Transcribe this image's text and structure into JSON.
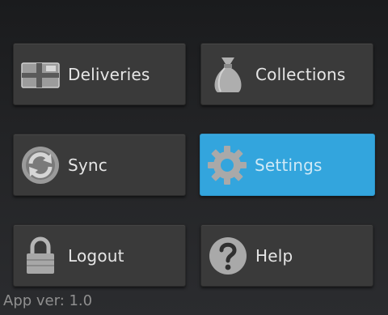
{
  "menu": {
    "deliveries": {
      "label": "Deliveries",
      "icon": "parcel-icon"
    },
    "collections": {
      "label": "Collections",
      "icon": "sack-icon"
    },
    "sync": {
      "label": "Sync",
      "icon": "sync-icon"
    },
    "settings": {
      "label": "Settings",
      "icon": "gear-icon",
      "state": "highlighted"
    },
    "logout": {
      "label": "Logout",
      "icon": "padlock-icon"
    },
    "help": {
      "label": "Help",
      "icon": "question-icon"
    }
  },
  "footer": {
    "version_text": "App ver: 1.0"
  },
  "colors": {
    "tile_background": "#3a3a3a",
    "tile_highlight": "#33a5dd",
    "label_text": "#e6e6e6",
    "icon_gray": "#a8a8a8"
  }
}
